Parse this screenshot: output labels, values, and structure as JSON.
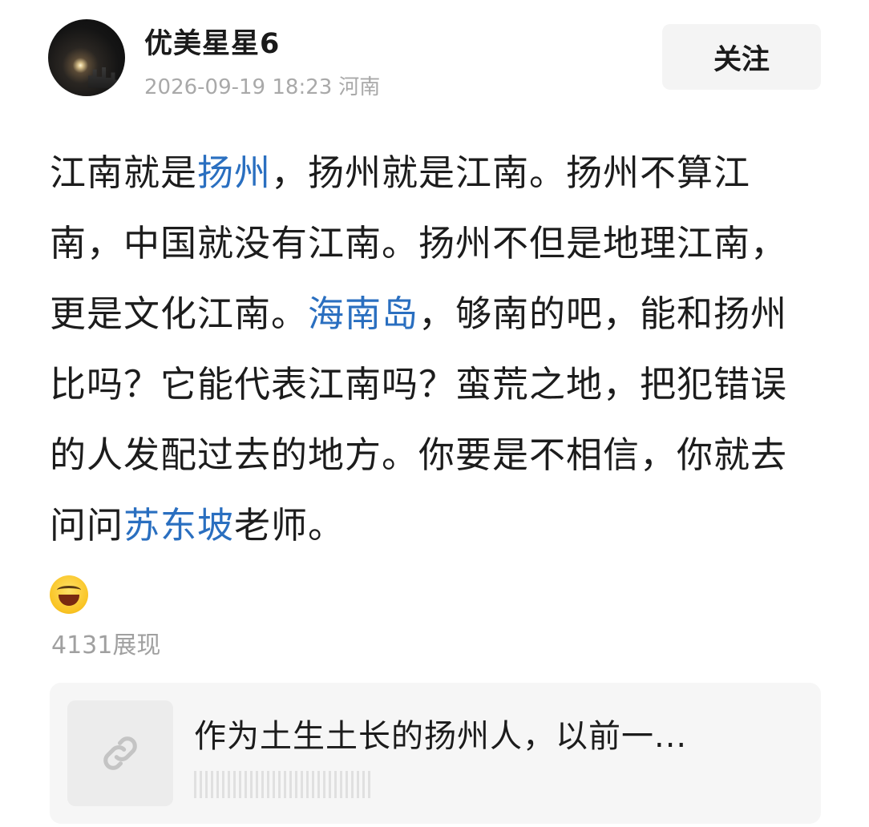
{
  "author": {
    "name": "优美星星6",
    "date": "2026-09-19 18:23",
    "location": "河南"
  },
  "follow_button": {
    "label": "关注"
  },
  "post": {
    "segments": [
      {
        "text": "江南就是",
        "link": false
      },
      {
        "text": "扬州",
        "link": true
      },
      {
        "text": "，扬州就是江南。扬州不算江南，中国就没有江南。扬州不但是地理江南，更是文化江南。",
        "link": false
      },
      {
        "text": "海南岛",
        "link": true
      },
      {
        "text": "，够南的吧，能和扬州比吗？它能代表江南吗？蛮荒之地，把犯错误的人发配过去的地方。你要是不相信，你就去问问",
        "link": false
      },
      {
        "text": "苏东坡",
        "link": true
      },
      {
        "text": "老师。",
        "link": false
      }
    ],
    "emoji": "laughing-emoji"
  },
  "stats": {
    "views": "4131展现"
  },
  "link_card": {
    "title": "作为土生土长的扬州人，以前一...",
    "icon": "link-icon"
  },
  "colors": {
    "link": "#2a6fc0",
    "meta": "#a9a9a9",
    "button_bg": "#f4f4f4",
    "card_bg": "#f6f6f6"
  }
}
